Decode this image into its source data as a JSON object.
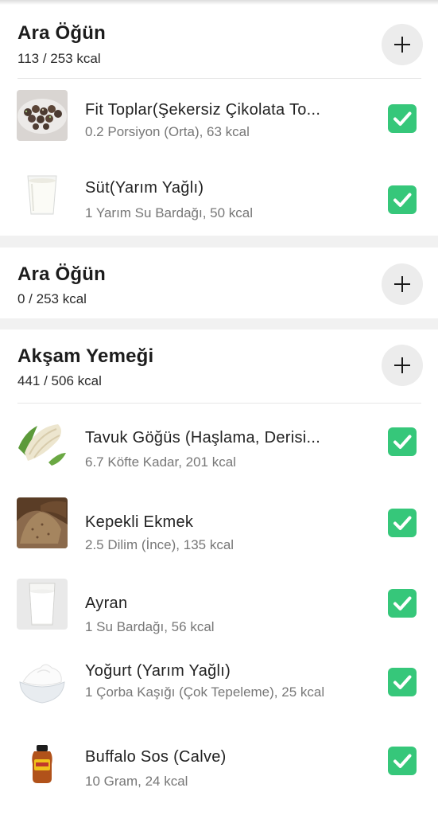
{
  "colors": {
    "check": "#36c77a",
    "page_bg": "#f1f1f1",
    "card_bg": "#ffffff",
    "add_button_bg": "#ececec"
  },
  "meals": [
    {
      "title": "Ara Öğün",
      "kcal": "113 / 253 kcal",
      "add_icon": "plus-icon",
      "items": [
        {
          "name": "Fit Toplar(Şekersiz Çikolata To...",
          "desc": "0.2 Porsiyon (Orta), 63 kcal",
          "thumb": "chocolate-balls-photo",
          "checked": true
        },
        {
          "name": "Süt(Yarım Yağlı)",
          "desc": "1 Yarım Su Bardağı, 50 kcal",
          "thumb": "milk-glass-photo",
          "checked": true
        }
      ]
    },
    {
      "title": "Ara Öğün",
      "kcal": "0 / 253 kcal",
      "add_icon": "plus-icon",
      "items": []
    },
    {
      "title": "Akşam Yemeği",
      "kcal": "441 / 506 kcal",
      "add_icon": "plus-icon",
      "items": [
        {
          "name": "Tavuk Göğüs (Haşlama, Derisi...",
          "desc": "6.7 Köfte Kadar, 201 kcal",
          "thumb": "chicken-breast-photo",
          "checked": true
        },
        {
          "name": "Kepekli Ekmek",
          "desc": "2.5 Dilim (İnce), 135 kcal",
          "thumb": "bran-bread-photo",
          "checked": true
        },
        {
          "name": "Ayran",
          "desc": "1 Su Bardağı, 56 kcal",
          "thumb": "ayran-glass-photo",
          "checked": true
        },
        {
          "name": "Yoğurt (Yarım Yağlı)",
          "desc": "1 Çorba Kaşığı (Çok Tepeleme), 25 kcal",
          "thumb": "yogurt-bowl-photo",
          "checked": true
        },
        {
          "name": "Buffalo Sos (Calve)",
          "desc": "10 Gram, 24 kcal",
          "thumb": "buffalo-sauce-bottle-photo",
          "checked": true
        }
      ]
    }
  ]
}
